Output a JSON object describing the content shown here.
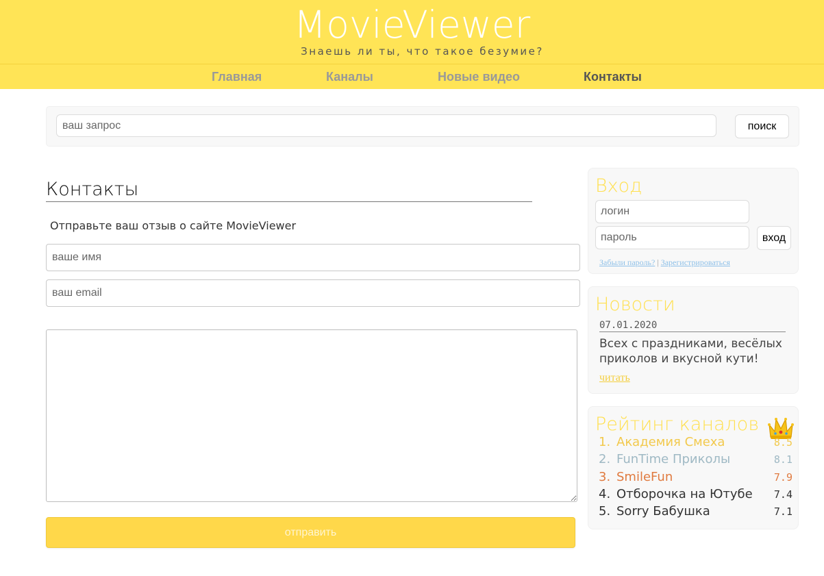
{
  "header": {
    "logo": "MovieViewer",
    "tagline": "Знаешь ли ты, что такое безумие?"
  },
  "nav": {
    "items": [
      {
        "label": "Главная",
        "active": false
      },
      {
        "label": "Каналы",
        "active": false
      },
      {
        "label": "Новые видео",
        "active": false
      },
      {
        "label": "Контакты",
        "active": true
      }
    ]
  },
  "search": {
    "placeholder": "ваш запрос",
    "button_label": "поиск"
  },
  "contacts": {
    "title": "Контакты",
    "subtitle": "Отправьте ваш отзыв о сайте MovieViewer",
    "name_placeholder": "ваше имя",
    "email_placeholder": "ваш email",
    "send_label": "отправить"
  },
  "login": {
    "title": "Вход",
    "login_placeholder": "логин",
    "password_placeholder": "пароль",
    "button_label": "вход",
    "forgot_label": "Забыли пароль?",
    "separator": " | ",
    "register_label": "Зарегистрироваться"
  },
  "news": {
    "title": "Новости",
    "date": "07.01.2020",
    "text": "Всех с праздниками, весёлых приколов и вкусной кути!",
    "read_label": "читать"
  },
  "rating": {
    "title": "Рейтинг каналов",
    "icon": "crown-icon",
    "items": [
      {
        "num": "1.",
        "name": "Академия Смеха",
        "score": "8.5",
        "color": "#f2c94c"
      },
      {
        "num": "2.",
        "name": "FunTime Приколы",
        "score": "8.1",
        "color": "#9fb9c4"
      },
      {
        "num": "3.",
        "name": "SmileFun",
        "score": "7.9",
        "color": "#e07a3f"
      },
      {
        "num": "4.",
        "name": "Отборочка на Ютубе",
        "score": "7.4",
        "color": "#333333"
      },
      {
        "num": "5.",
        "name": "Sorry Бабушка",
        "score": "7.1",
        "color": "#333333"
      }
    ]
  },
  "colors": {
    "brand_yellow": "#ffe456",
    "accent_yellow": "#ffe04f",
    "button_yellow": "#ffd84a"
  }
}
